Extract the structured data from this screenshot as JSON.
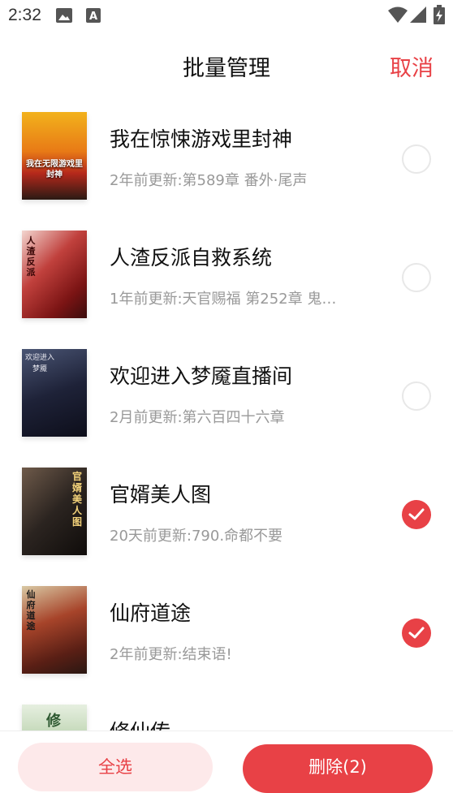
{
  "status": {
    "time": "2:32"
  },
  "header": {
    "title": "批量管理",
    "cancel": "取消"
  },
  "books": [
    {
      "title": "我在惊悚游戏里封神",
      "subtitle": "2年前更新:第589章 番外·尾声",
      "cover_text": "我在无限游戏里封神",
      "selected": false
    },
    {
      "title": "人渣反派自救系统",
      "subtitle": "1年前更新:天官赐福 第252章 鬼…",
      "cover_text": "人渣反派",
      "selected": false
    },
    {
      "title": "欢迎进入梦魇直播间",
      "subtitle": "2月前更新:第六百四十六章",
      "cover_text": "欢迎进入梦魇",
      "selected": false
    },
    {
      "title": "官婿美人图",
      "subtitle": "20天前更新:790.命都不要",
      "cover_text": "官婿美人图",
      "selected": true
    },
    {
      "title": "仙府道途",
      "subtitle": "2年前更新:结束语!",
      "cover_text": "仙府道途",
      "selected": true
    },
    {
      "title": "修仙传",
      "subtitle": "",
      "cover_text": "修",
      "selected": false
    }
  ],
  "bottom": {
    "select_all": "全选",
    "delete": "删除(2)"
  },
  "colors": {
    "accent": "#e84146",
    "accent_light": "#fde9ea"
  }
}
